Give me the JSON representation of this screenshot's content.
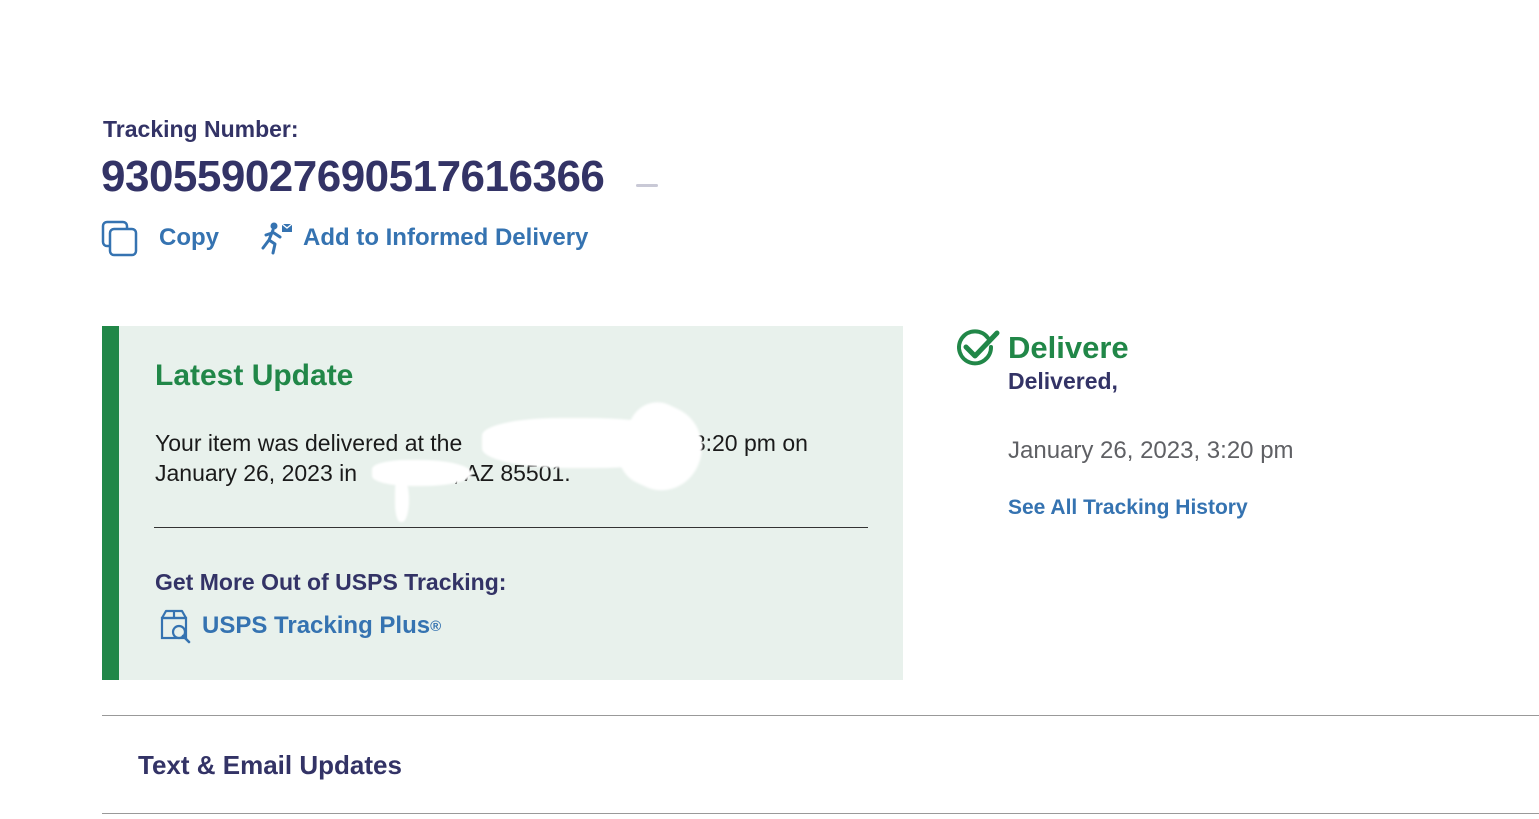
{
  "header": {
    "tracking_label": "Tracking Number:",
    "tracking_number": "930559027690517616366"
  },
  "actions": {
    "copy_label": "Copy",
    "copy_icon": "copy-icon",
    "informed_label": "Add to Informed Delivery",
    "informed_icon": "delivery-person-icon"
  },
  "latest_update": {
    "title": "Latest Update",
    "text_part1": "Your item was delivered at the",
    "text_part2": "at 3:20 pm on",
    "text_part3": "January 26, 2023 in",
    "text_part4": ", AZ 85501.",
    "promo_title": "Get More Out of USPS Tracking:",
    "promo_link": "USPS Tracking Plus",
    "promo_mark": "®",
    "promo_icon": "package-search-icon"
  },
  "status": {
    "headline": "Delivered",
    "detail": "Delivered,",
    "date": "January 26, 2023, 3:20 pm",
    "history_link": "See All Tracking History",
    "icon": "check-circle-icon"
  },
  "accordion": {
    "title": "Text & Email Updates"
  },
  "colors": {
    "navy": "#333366",
    "green": "#218748",
    "link_blue": "#3573b1",
    "panel_bg": "#e8f1ec"
  }
}
